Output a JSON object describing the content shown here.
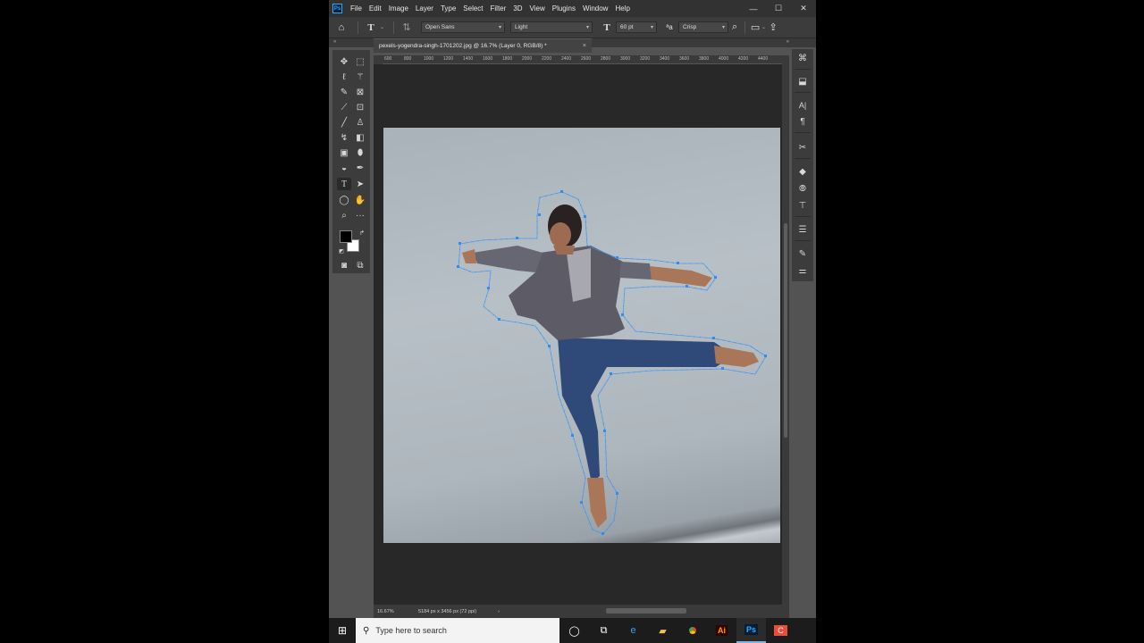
{
  "app": {
    "logo": "Ps"
  },
  "menu": [
    "File",
    "Edit",
    "Image",
    "Layer",
    "Type",
    "Select",
    "Filter",
    "3D",
    "View",
    "Plugins",
    "Window",
    "Help"
  ],
  "window_controls": {
    "minimize": "—",
    "maximize": "☐",
    "close": "✕"
  },
  "options_bar": {
    "font_family": "Open Sans",
    "font_style": "Light",
    "font_size": "60 pt",
    "antialias": "Crisp"
  },
  "document": {
    "tab_title": "pexels-yogendra-singh-1701202.jpg @ 16.7% (Layer 0, RGB/8) *",
    "close": "×"
  },
  "ruler_top": [
    "600",
    "800",
    "1000",
    "1200",
    "1400",
    "1600",
    "1800",
    "2000",
    "2200",
    "2400",
    "2600",
    "2800",
    "3000",
    "3200",
    "3400",
    "3600",
    "3800",
    "4000",
    "4200",
    "4400"
  ],
  "status": {
    "zoom": "16.67%",
    "doc_info": "5184 px x 3456 px (72 ppi)",
    "arrow": "›"
  },
  "taskbar": {
    "search_placeholder": "Type here to search",
    "apps": [
      "cortana-icon",
      "task-view-icon",
      "edge-icon",
      "file-explorer-icon",
      "chrome-icon",
      "illustrator-icon",
      "photoshop-icon",
      "app-icon"
    ]
  },
  "colors": {
    "accent": "#31a8ff",
    "selection": "#2f8df0",
    "panel": "#535353"
  }
}
